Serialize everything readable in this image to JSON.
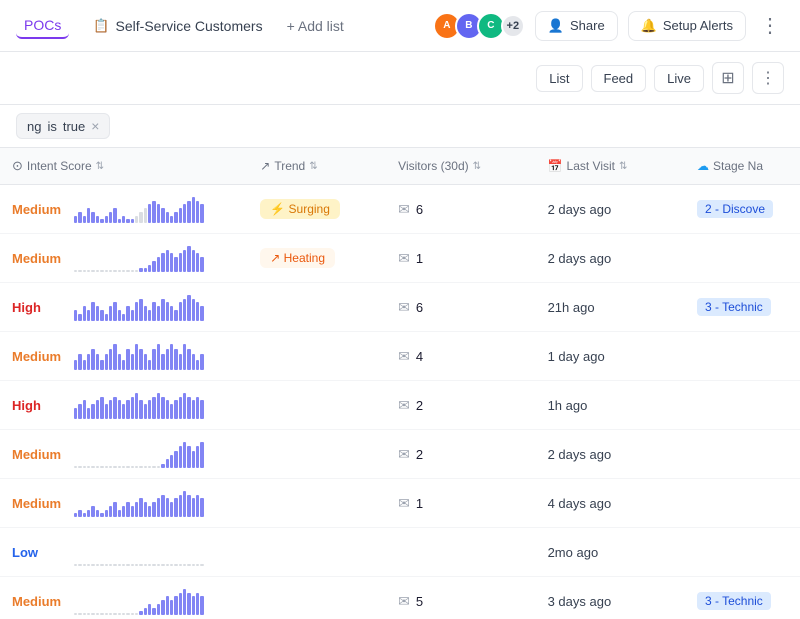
{
  "header": {
    "tab_pocs": "POCs",
    "tab_self_service": "Self-Service Customers",
    "add_list": "+ Add list",
    "avatar_count": "+2",
    "share_label": "Share",
    "setup_alerts_label": "Setup Alerts",
    "more_icon": "⋯"
  },
  "toolbar": {
    "list_label": "List",
    "feed_label": "Feed",
    "live_label": "Live",
    "columns_icon": "⊞",
    "more_icon": "⋮"
  },
  "filter": {
    "text": "ng",
    "operator": "is",
    "value": "true",
    "close": "×"
  },
  "columns": [
    {
      "id": "intent_score",
      "label": "Intent Score",
      "icon": "⊙"
    },
    {
      "id": "trend",
      "label": "Trend",
      "icon": "↗"
    },
    {
      "id": "visitors",
      "label": "Visitors (30d)",
      "icon": ""
    },
    {
      "id": "last_visit",
      "label": "Last Visit",
      "icon": "📅"
    },
    {
      "id": "stage",
      "label": "Stage Na",
      "icon": "☁"
    }
  ],
  "rows": [
    {
      "score": "Medium",
      "score_level": "medium",
      "chart": [
        2,
        3,
        2,
        4,
        3,
        2,
        1,
        2,
        3,
        4,
        1,
        2,
        1,
        1,
        2,
        3,
        4,
        5,
        6,
        5,
        4,
        3,
        2,
        3,
        4,
        5,
        6,
        7,
        6,
        5
      ],
      "chart_light": [
        0,
        0,
        0,
        0,
        0,
        0,
        0,
        0,
        0,
        0,
        0,
        0,
        0,
        0,
        1,
        1,
        1,
        0,
        0,
        0,
        0,
        0,
        0,
        0,
        0,
        0,
        0,
        0,
        0,
        0
      ],
      "trend": "Surging",
      "trend_type": "surging",
      "visitors": "6",
      "last_visit": "2 days ago",
      "stage": "2 - Discove"
    },
    {
      "score": "Medium",
      "score_level": "medium",
      "chart": [
        0,
        0,
        0,
        0,
        0,
        0,
        0,
        0,
        0,
        0,
        0,
        0,
        0,
        0,
        0,
        1,
        1,
        2,
        3,
        4,
        5,
        6,
        5,
        4,
        5,
        6,
        7,
        6,
        5,
        4
      ],
      "chart_light": [
        1,
        1,
        1,
        1,
        1,
        1,
        1,
        1,
        1,
        1,
        1,
        1,
        1,
        1,
        1,
        0,
        0,
        0,
        0,
        0,
        0,
        0,
        0,
        0,
        0,
        0,
        0,
        0,
        0,
        0
      ],
      "trend": "Heating",
      "trend_type": "heating",
      "visitors": "1",
      "last_visit": "2 days ago",
      "stage": ""
    },
    {
      "score": "High",
      "score_level": "high",
      "chart": [
        3,
        2,
        4,
        3,
        5,
        4,
        3,
        2,
        4,
        5,
        3,
        2,
        4,
        3,
        5,
        6,
        4,
        3,
        5,
        4,
        6,
        5,
        4,
        3,
        5,
        6,
        7,
        6,
        5,
        4
      ],
      "chart_light": [
        0,
        0,
        0,
        0,
        0,
        0,
        0,
        0,
        0,
        0,
        0,
        0,
        0,
        0,
        0,
        0,
        0,
        0,
        0,
        0,
        0,
        0,
        0,
        0,
        0,
        0,
        0,
        0,
        0,
        0
      ],
      "trend": "",
      "trend_type": "",
      "visitors": "6",
      "last_visit": "21h ago",
      "stage": "3 - Technic"
    },
    {
      "score": "Medium",
      "score_level": "medium",
      "chart": [
        2,
        3,
        2,
        3,
        4,
        3,
        2,
        3,
        4,
        5,
        3,
        2,
        4,
        3,
        5,
        4,
        3,
        2,
        4,
        5,
        3,
        4,
        5,
        4,
        3,
        5,
        4,
        3,
        2,
        3
      ],
      "chart_light": [
        0,
        0,
        0,
        0,
        0,
        0,
        0,
        0,
        0,
        0,
        0,
        0,
        0,
        0,
        0,
        0,
        0,
        0,
        0,
        0,
        0,
        0,
        0,
        0,
        0,
        0,
        0,
        0,
        0,
        0
      ],
      "trend": "",
      "trend_type": "",
      "visitors": "4",
      "last_visit": "1 day ago",
      "stage": ""
    },
    {
      "score": "High",
      "score_level": "high",
      "chart": [
        3,
        4,
        5,
        3,
        4,
        5,
        6,
        4,
        5,
        6,
        5,
        4,
        5,
        6,
        7,
        5,
        4,
        5,
        6,
        7,
        6,
        5,
        4,
        5,
        6,
        7,
        6,
        5,
        6,
        5
      ],
      "chart_light": [
        0,
        0,
        0,
        0,
        0,
        0,
        0,
        0,
        0,
        0,
        0,
        0,
        0,
        0,
        0,
        0,
        0,
        0,
        0,
        0,
        0,
        0,
        0,
        0,
        0,
        0,
        0,
        0,
        0,
        0
      ],
      "trend": "",
      "trend_type": "",
      "visitors": "2",
      "last_visit": "1h ago",
      "stage": ""
    },
    {
      "score": "Medium",
      "score_level": "medium",
      "chart": [
        0,
        0,
        0,
        0,
        0,
        0,
        0,
        0,
        0,
        0,
        0,
        0,
        0,
        0,
        0,
        0,
        0,
        0,
        0,
        0,
        1,
        2,
        3,
        4,
        5,
        6,
        5,
        4,
        5,
        6
      ],
      "chart_light": [
        1,
        1,
        1,
        1,
        1,
        1,
        1,
        1,
        1,
        1,
        1,
        1,
        1,
        1,
        1,
        1,
        1,
        1,
        1,
        1,
        0,
        0,
        0,
        0,
        0,
        0,
        0,
        0,
        0,
        0
      ],
      "trend": "",
      "trend_type": "",
      "visitors": "2",
      "last_visit": "2 days ago",
      "stage": ""
    },
    {
      "score": "Medium",
      "score_level": "medium",
      "chart": [
        1,
        2,
        1,
        2,
        3,
        2,
        1,
        2,
        3,
        4,
        2,
        3,
        4,
        3,
        4,
        5,
        4,
        3,
        4,
        5,
        6,
        5,
        4,
        5,
        6,
        7,
        6,
        5,
        6,
        5
      ],
      "chart_light": [
        0,
        0,
        0,
        0,
        0,
        0,
        0,
        0,
        0,
        0,
        0,
        0,
        0,
        0,
        0,
        0,
        0,
        0,
        0,
        0,
        0,
        0,
        0,
        0,
        0,
        0,
        0,
        0,
        0,
        0
      ],
      "trend": "",
      "trend_type": "",
      "visitors": "1",
      "last_visit": "4 days ago",
      "stage": ""
    },
    {
      "score": "Low",
      "score_level": "low",
      "chart": [
        0,
        0,
        0,
        0,
        0,
        0,
        0,
        0,
        0,
        0,
        0,
        0,
        0,
        0,
        0,
        0,
        0,
        0,
        0,
        0,
        0,
        0,
        0,
        0,
        0,
        0,
        0,
        0,
        0,
        0
      ],
      "chart_light": [
        1,
        1,
        1,
        1,
        1,
        1,
        1,
        1,
        1,
        1,
        1,
        1,
        1,
        1,
        1,
        1,
        1,
        1,
        1,
        1,
        1,
        1,
        1,
        1,
        1,
        1,
        1,
        1,
        1,
        1
      ],
      "trend": "",
      "trend_type": "",
      "visitors": "",
      "last_visit": "2mo ago",
      "stage": ""
    },
    {
      "score": "Medium",
      "score_level": "medium",
      "chart": [
        0,
        0,
        0,
        0,
        0,
        0,
        0,
        0,
        0,
        0,
        0,
        0,
        0,
        0,
        0,
        1,
        2,
        3,
        2,
        3,
        4,
        5,
        4,
        5,
        6,
        7,
        6,
        5,
        6,
        5
      ],
      "chart_light": [
        1,
        1,
        1,
        1,
        1,
        1,
        1,
        1,
        1,
        1,
        1,
        1,
        1,
        1,
        1,
        0,
        0,
        0,
        0,
        0,
        0,
        0,
        0,
        0,
        0,
        0,
        0,
        0,
        0,
        0
      ],
      "trend": "",
      "trend_type": "",
      "visitors": "5",
      "last_visit": "3 days ago",
      "stage": "3 - Technic"
    }
  ],
  "avatars": [
    {
      "color": "#f97316",
      "initials": "A"
    },
    {
      "color": "#6366f1",
      "initials": "B"
    },
    {
      "color": "#10b981",
      "initials": "C"
    }
  ]
}
